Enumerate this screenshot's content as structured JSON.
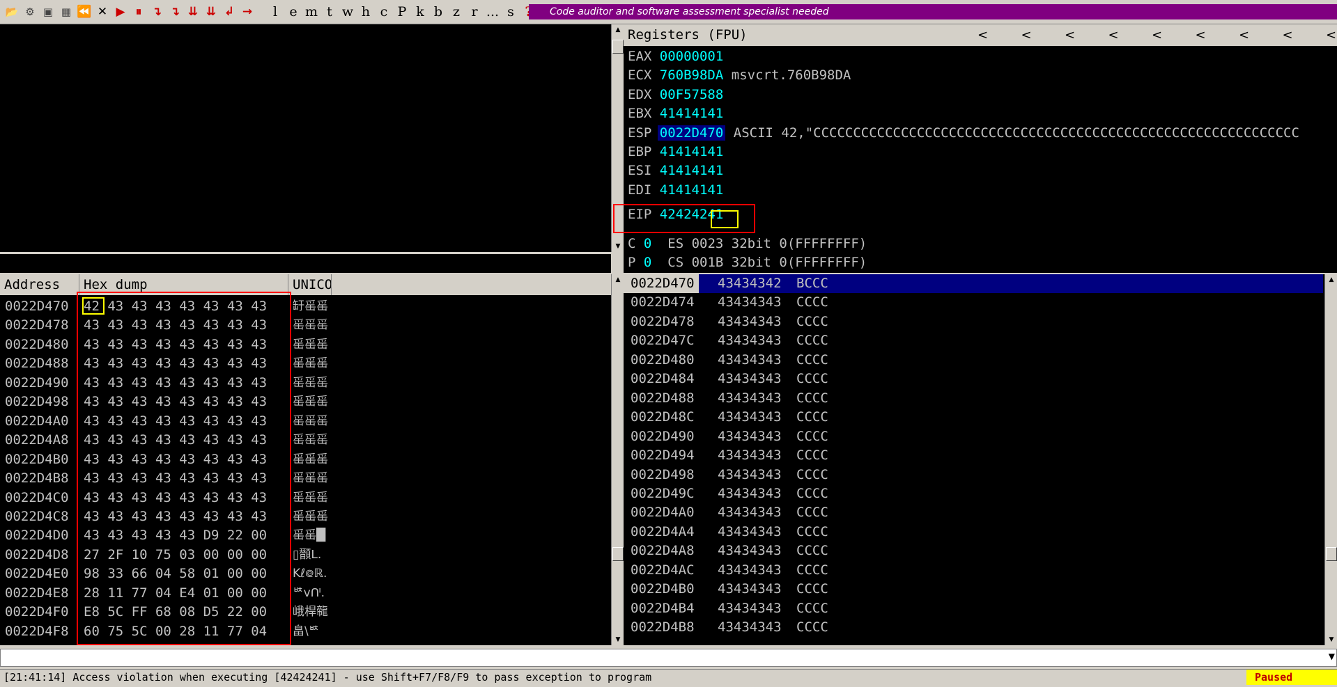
{
  "toolbar": {
    "icons": [
      {
        "name": "open-icon",
        "glyph": "📂"
      },
      {
        "name": "attach-icon",
        "glyph": "⚙"
      },
      {
        "name": "window-icon",
        "glyph": "▣"
      },
      {
        "name": "patch-icon",
        "glyph": "▦"
      },
      {
        "name": "rewind-icon",
        "glyph": "⏪"
      },
      {
        "name": "close-icon",
        "glyph": "✕"
      },
      {
        "name": "run-icon",
        "glyph": "▶"
      },
      {
        "name": "pause-icon",
        "glyph": "⏸"
      },
      {
        "name": "step-into-icon",
        "glyph": "↴"
      },
      {
        "name": "step-over-icon",
        "glyph": "↴"
      },
      {
        "name": "trace-into-icon",
        "glyph": "⇊"
      },
      {
        "name": "trace-over-icon",
        "glyph": "⇊"
      },
      {
        "name": "execute-till-return-icon",
        "glyph": "↲"
      },
      {
        "name": "goto-icon",
        "glyph": "→"
      }
    ],
    "letters": [
      "l",
      "e",
      "m",
      "t",
      "w",
      "h",
      "c",
      "P",
      "k",
      "b",
      "z",
      "r",
      "...",
      "s",
      "?"
    ],
    "banner": "Code auditor and software assessment specialist needed"
  },
  "registers": {
    "title": "Registers (FPU)",
    "arrows": [
      "<",
      "<",
      "<",
      "<",
      "<",
      "<",
      "<",
      "<",
      "<"
    ],
    "rows": [
      {
        "name": "EAX",
        "value": "00000001",
        "comment": ""
      },
      {
        "name": "ECX",
        "value": "760B98DA",
        "comment": "msvcrt.760B98DA"
      },
      {
        "name": "EDX",
        "value": "00F57588",
        "comment": ""
      },
      {
        "name": "EBX",
        "value": "41414141",
        "comment": ""
      },
      {
        "name": "ESP",
        "value": "0022D470",
        "comment": "ASCII 42,\"CCCCCCCCCCCCCCCCCCCCCCCCCCCCCCCCCCCCCCCCCCCCCCCCCCCCCCCCCCCCC"
      },
      {
        "name": "EBP",
        "value": "41414141",
        "comment": ""
      },
      {
        "name": "ESI",
        "value": "41414141",
        "comment": ""
      },
      {
        "name": "EDI",
        "value": "41414141",
        "comment": ""
      }
    ],
    "eip": {
      "name": "EIP",
      "value": "42424241"
    },
    "flags": [
      {
        "name": "C",
        "value": "0",
        "segment": "ES 0023 32bit 0(FFFFFFFF)"
      },
      {
        "name": "P",
        "value": "0",
        "segment": "CS 001B 32bit 0(FFFFFFFF)"
      }
    ]
  },
  "dump": {
    "headers": {
      "address": "Address",
      "hex": "Hex dump",
      "unicode": "UNICO"
    },
    "rows": [
      {
        "addr": "0022D470",
        "hex": "42 43 43 43 43 43 43 43",
        "uni": "䍂䍃䍃"
      },
      {
        "addr": "0022D478",
        "hex": "43 43 43 43 43 43 43 43",
        "uni": "䍃䍃䍃"
      },
      {
        "addr": "0022D480",
        "hex": "43 43 43 43 43 43 43 43",
        "uni": "䍃䍃䍃"
      },
      {
        "addr": "0022D488",
        "hex": "43 43 43 43 43 43 43 43",
        "uni": "䍃䍃䍃"
      },
      {
        "addr": "0022D490",
        "hex": "43 43 43 43 43 43 43 43",
        "uni": "䍃䍃䍃"
      },
      {
        "addr": "0022D498",
        "hex": "43 43 43 43 43 43 43 43",
        "uni": "䍃䍃䍃"
      },
      {
        "addr": "0022D4A0",
        "hex": "43 43 43 43 43 43 43 43",
        "uni": "䍃䍃䍃"
      },
      {
        "addr": "0022D4A8",
        "hex": "43 43 43 43 43 43 43 43",
        "uni": "䍃䍃䍃"
      },
      {
        "addr": "0022D4B0",
        "hex": "43 43 43 43 43 43 43 43",
        "uni": "䍃䍃䍃"
      },
      {
        "addr": "0022D4B8",
        "hex": "43 43 43 43 43 43 43 43",
        "uni": "䍃䍃䍃"
      },
      {
        "addr": "0022D4C0",
        "hex": "43 43 43 43 43 43 43 43",
        "uni": "䍃䍃䍃"
      },
      {
        "addr": "0022D4C8",
        "hex": "43 43 43 43 43 43 43 43",
        "uni": "䍃䍃䍃"
      },
      {
        "addr": "0022D4D0",
        "hex": "43 43 43 43 43 D9 22 00",
        "uni": "䍃䍃█"
      },
      {
        "addr": "0022D4D8",
        "hex": "27 2F 10 75 03 00 00 00",
        "uni": "▯䫬ᒪ."
      },
      {
        "addr": "0022D4E0",
        "hex": "98 33 66 04 58 01 00 00",
        "uni": "Kℓ᪤ℝ."
      },
      {
        "addr": "0022D4E8",
        "hex": "28 11 77 04 E4 01 00 00",
        "uni": "ᄨᴠᑨ."
      },
      {
        "addr": "0022D4F0",
        "hex": "E8 5C FF 68 08 D5 22 00",
        "uni": "峨桿㡣"
      },
      {
        "addr": "0022D4F8",
        "hex": "60 75 5C 00 28 11 77 04",
        "uni": "畠\\ᄨ"
      }
    ]
  },
  "stack": {
    "rows": [
      {
        "addr": "0022D470",
        "value": "43434342",
        "comment": "BCCC"
      },
      {
        "addr": "0022D474",
        "value": "43434343",
        "comment": "CCCC"
      },
      {
        "addr": "0022D478",
        "value": "43434343",
        "comment": "CCCC"
      },
      {
        "addr": "0022D47C",
        "value": "43434343",
        "comment": "CCCC"
      },
      {
        "addr": "0022D480",
        "value": "43434343",
        "comment": "CCCC"
      },
      {
        "addr": "0022D484",
        "value": "43434343",
        "comment": "CCCC"
      },
      {
        "addr": "0022D488",
        "value": "43434343",
        "comment": "CCCC"
      },
      {
        "addr": "0022D48C",
        "value": "43434343",
        "comment": "CCCC"
      },
      {
        "addr": "0022D490",
        "value": "43434343",
        "comment": "CCCC"
      },
      {
        "addr": "0022D494",
        "value": "43434343",
        "comment": "CCCC"
      },
      {
        "addr": "0022D498",
        "value": "43434343",
        "comment": "CCCC"
      },
      {
        "addr": "0022D49C",
        "value": "43434343",
        "comment": "CCCC"
      },
      {
        "addr": "0022D4A0",
        "value": "43434343",
        "comment": "CCCC"
      },
      {
        "addr": "0022D4A4",
        "value": "43434343",
        "comment": "CCCC"
      },
      {
        "addr": "0022D4A8",
        "value": "43434343",
        "comment": "CCCC"
      },
      {
        "addr": "0022D4AC",
        "value": "43434343",
        "comment": "CCCC"
      },
      {
        "addr": "0022D4B0",
        "value": "43434343",
        "comment": "CCCC"
      },
      {
        "addr": "0022D4B4",
        "value": "43434343",
        "comment": "CCCC"
      },
      {
        "addr": "0022D4B8",
        "value": "43434343",
        "comment": "CCCC"
      }
    ]
  },
  "status": {
    "message": "[21:41:14] Access violation when executing [42424241] - use Shift+F7/F8/F9 to pass exception to program",
    "state": "Paused"
  },
  "colors": {
    "banner": "#800080",
    "register_value": "#00ffff",
    "selection": "#000080",
    "annotation_red": "#ff0000",
    "annotation_yellow": "#ffff00",
    "status_paused_bg": "#ffff00"
  }
}
